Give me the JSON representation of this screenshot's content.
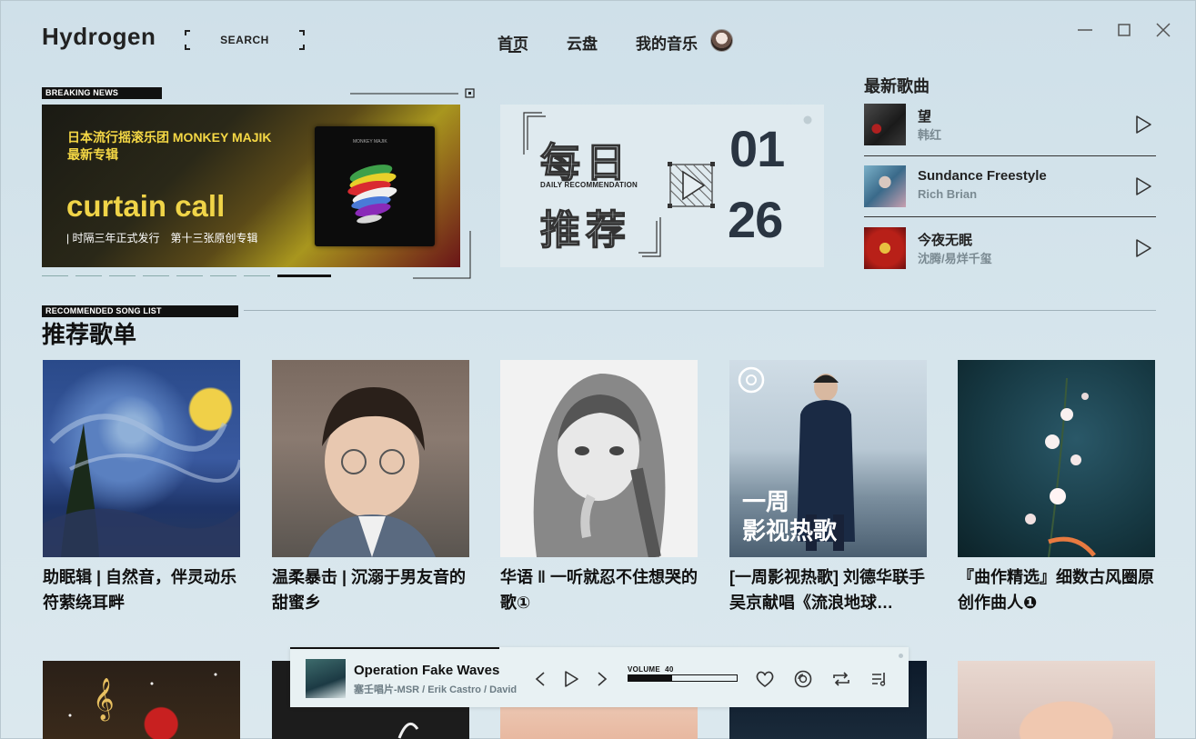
{
  "app": {
    "title": "Hydrogen"
  },
  "search": {
    "label": "SEARCH"
  },
  "nav": {
    "home": "首页",
    "cloud": "云盘",
    "mymusic": "我的音乐"
  },
  "banner": {
    "tag": "BREAKING NEWS",
    "line1": "日本流行摇滚乐团 MONKEY MAJIK",
    "line2": "最新专辑",
    "title": "curtain call",
    "sub": "| 时隔三年正式发行　第十三张原创专辑",
    "slides": 8,
    "active_slide": 8
  },
  "daily": {
    "cn1": "每日",
    "cn2": "推荐",
    "en": "DAILY RECOMMENDATION",
    "month": "01",
    "day": "26"
  },
  "latest": {
    "title": "最新歌曲",
    "songs": [
      {
        "name": "望",
        "artist": "韩红"
      },
      {
        "name": "Sundance Freestyle",
        "artist": "Rich Brian"
      },
      {
        "name": "今夜无眠",
        "artist": "沈腾/易烊千玺"
      }
    ]
  },
  "recommended": {
    "tag": "RECOMMENDED SONG LIST",
    "title": "推荐歌单",
    "lists": [
      {
        "title": "助眠辑 | 自然音，伴灵动乐符萦绕耳畔"
      },
      {
        "title": "温柔暴击 | 沉溺于男友音的甜蜜乡"
      },
      {
        "title": "华语 ‖ 一听就忍不住想哭的歌①"
      },
      {
        "title": "[一周影视热歌] 刘德华联手吴京献唱《流浪地球…"
      },
      {
        "title": "『曲作精选』细数古风圈原创作曲人❶"
      }
    ],
    "cover4_text": [
      "一周",
      "影视热歌"
    ]
  },
  "player": {
    "song": "Operation Fake Waves",
    "artist": "塞壬唱片-MSR / Erik Castro / David…",
    "volume_label": "VOLUME",
    "volume": "40",
    "volume_fraction": 0.4
  },
  "icons": [
    "minimize-icon",
    "maximize-icon",
    "close-icon",
    "play-icon",
    "prev-icon",
    "next-icon",
    "heart-icon",
    "disc-icon",
    "repeat-icon",
    "playlist-icon"
  ]
}
